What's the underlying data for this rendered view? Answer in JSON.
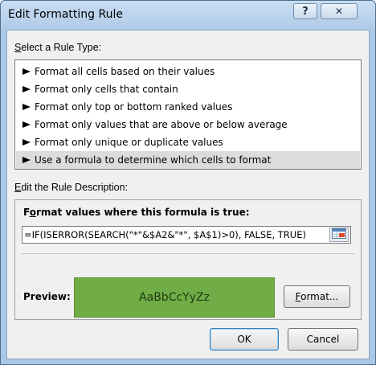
{
  "window": {
    "title": "Edit Formatting Rule",
    "help_glyph": "?",
    "close_glyph": "✕"
  },
  "rule_type": {
    "label_accel": "S",
    "label_rest": "elect a Rule Type:",
    "items": [
      {
        "label": "Format all cells based on their values",
        "selected": false
      },
      {
        "label": "Format only cells that contain",
        "selected": false
      },
      {
        "label": "Format only top or bottom ranked values",
        "selected": false
      },
      {
        "label": "Format only values that are above or below average",
        "selected": false
      },
      {
        "label": "Format only unique or duplicate values",
        "selected": false
      },
      {
        "label": "Use a formula to determine which cells to format",
        "selected": true
      }
    ]
  },
  "description": {
    "label_accel": "E",
    "label_rest": "dit the Rule Description:",
    "formula_heading_pre": "F",
    "formula_heading_accel": "o",
    "formula_heading_rest": "rmat values where this formula is true:",
    "formula_value": "=IF(ISERROR(SEARCH(\"*\"&$A2&\"*\", $A$1)>0), FALSE, TRUE)",
    "preview_label": "Preview:",
    "preview_sample": "AaBbCcYyZz",
    "preview_fill": "#70ad47",
    "format_button_accel": "F",
    "format_button_rest": "ormat..."
  },
  "buttons": {
    "ok": "OK",
    "cancel": "Cancel"
  }
}
